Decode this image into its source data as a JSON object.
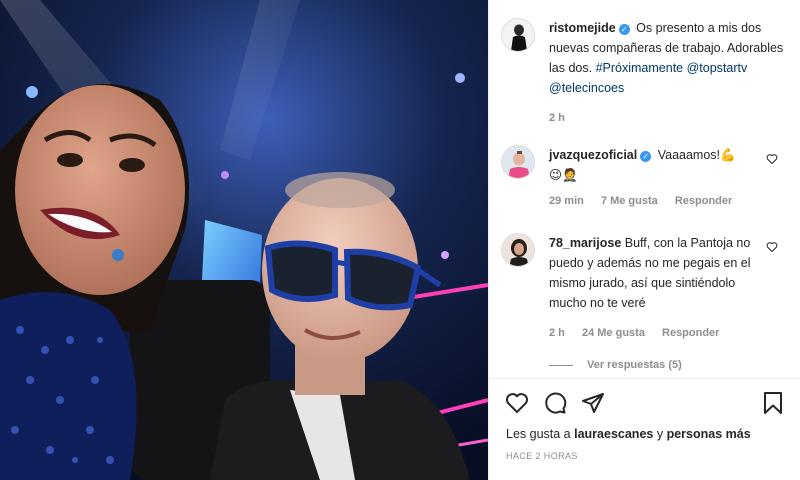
{
  "post": {
    "author": "ristomejide",
    "caption_text": "Os presento a mis dos nuevas compañeras de trabajo. Adorables las dos.",
    "hashtag": "#Próximamente",
    "mention_1": "@topstartv",
    "mention_2": "@telecincoes",
    "time": "2 h"
  },
  "comments": [
    {
      "user": "jvazquezoficial",
      "text": "Vaaaamos!💪",
      "emoji_line": "😉🤵",
      "time": "29 min",
      "likes": "7 Me gusta",
      "reply": "Responder"
    },
    {
      "user": "78_marijose",
      "text": "Buff, con la Pantoja no puedo y además no me pegais en el mismo jurado, así que sintiéndolo mucho no te veré",
      "time": "2 h",
      "likes": "24 Me gusta",
      "reply": "Responder",
      "view_replies": "Ver respuestas (5)"
    }
  ],
  "likes_line": {
    "prefix": "Les gusta a",
    "user": "lauraescanes",
    "middle": "y",
    "suffix": "personas más"
  },
  "posted_ago": "HACE 2 HORAS",
  "icons": {
    "like": "heart-icon",
    "comment": "comment-icon",
    "share": "send-icon",
    "save": "bookmark-icon"
  },
  "colors": {
    "link": "#00376b",
    "verified": "#3897f0",
    "muted": "#8e8e8e"
  }
}
